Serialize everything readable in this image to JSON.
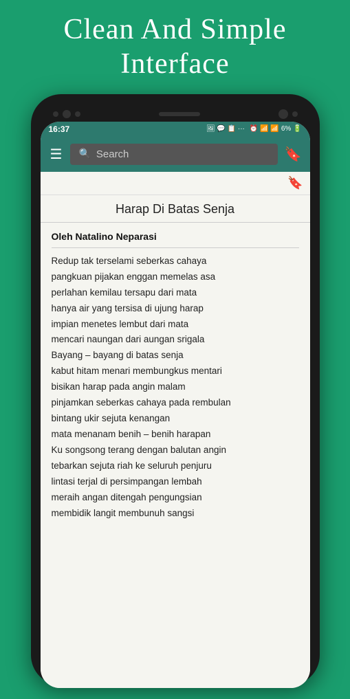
{
  "hero": {
    "title": "Clean And Simple Interface"
  },
  "status_bar": {
    "time": "16:37",
    "icons_left": "🖼 💬 📋 ...",
    "icons_right": "⏰ 📶 📶 6%"
  },
  "toolbar": {
    "search_placeholder": "Search",
    "menu_label": "☰",
    "bookmark_label": "🔖"
  },
  "poem": {
    "title": "Harap Di Batas Senja",
    "author": "Oleh Natalino Neparasi",
    "lines": [
      "Redup tak terselami seberkas cahaya",
      "pangkuan pijakan enggan memelas asa",
      "perlahan kemilau tersapu dari mata",
      "hanya air yang tersisa di ujung harap",
      "impian menetes lembut dari mata",
      "mencari naungan dari aungan srigala",
      "Bayang – bayang di batas senja",
      "kabut hitam menari membungkus mentari",
      "bisikan harap pada angin malam",
      "pinjamkan seberkas cahaya pada rembulan",
      "bintang ukir sejuta kenangan",
      "mata menanam benih – benih harapan",
      "Ku songsong terang dengan balutan angin",
      "tebarkan sejuta riah ke seluruh penjuru",
      "lintasi terjal di persimpangan lembah",
      "meraih angan ditengah pengungsian",
      "membidik langit membunuh sangsi"
    ]
  },
  "colors": {
    "background_green": "#1a9e6e",
    "app_bar": "#2d7a6e",
    "content_bg": "#f5f5f0",
    "phone_body": "#1a1a1a"
  }
}
